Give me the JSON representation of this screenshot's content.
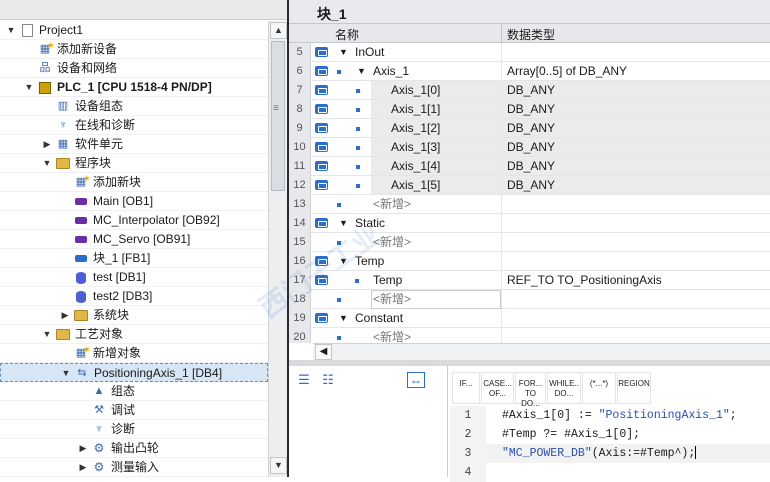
{
  "tree": {
    "items": [
      {
        "label": "Project1",
        "icon": "project-icon",
        "arrow": "▼",
        "indent": 0
      },
      {
        "label": "添加新设备",
        "icon": "add-device-icon",
        "arrow": "",
        "indent": 1
      },
      {
        "label": "设备和网络",
        "icon": "network-icon",
        "arrow": "",
        "indent": 1
      },
      {
        "label": "PLC_1 [CPU 1518-4 PN/DP]",
        "icon": "plc-icon",
        "arrow": "▼",
        "indent": 1,
        "bold": true
      },
      {
        "label": "设备组态",
        "icon": "device-config-icon",
        "arrow": "",
        "indent": 2
      },
      {
        "label": "在线和诊断",
        "icon": "online-diagnostics-icon",
        "arrow": "",
        "indent": 2
      },
      {
        "label": "软件单元",
        "icon": "software-units-icon",
        "arrow": "▶",
        "indent": 2
      },
      {
        "label": "程序块",
        "icon": "folder-icon",
        "arrow": "▼",
        "indent": 2
      },
      {
        "label": "添加新块",
        "icon": "add-block-icon",
        "arrow": "",
        "indent": 3
      },
      {
        "label": "Main [OB1]",
        "icon": "ob-icon",
        "arrow": "",
        "indent": 3
      },
      {
        "label": "MC_Interpolator [OB92]",
        "icon": "ob-icon",
        "arrow": "",
        "indent": 3
      },
      {
        "label": "MC_Servo [OB91]",
        "icon": "ob-icon",
        "arrow": "",
        "indent": 3
      },
      {
        "label": "块_1 [FB1]",
        "icon": "fb-icon",
        "arrow": "",
        "indent": 3
      },
      {
        "label": "test [DB1]",
        "icon": "db-icon",
        "arrow": "",
        "indent": 3
      },
      {
        "label": "test2 [DB3]",
        "icon": "db-icon",
        "arrow": "",
        "indent": 3
      },
      {
        "label": "系统块",
        "icon": "folder-icon",
        "arrow": "▶",
        "indent": 3
      },
      {
        "label": "工艺对象",
        "icon": "folder-icon",
        "arrow": "▼",
        "indent": 2
      },
      {
        "label": "新增对象",
        "icon": "add-object-icon",
        "arrow": "",
        "indent": 3
      },
      {
        "label": "PositioningAxis_1 [DB4]",
        "icon": "axis-icon",
        "arrow": "▼",
        "indent": 3,
        "selected": true
      },
      {
        "label": "组态",
        "icon": "configuration-icon",
        "arrow": "",
        "indent": 4
      },
      {
        "label": "调试",
        "icon": "commissioning-icon",
        "arrow": "",
        "indent": 4
      },
      {
        "label": "诊断",
        "icon": "diagnostics-icon",
        "arrow": "",
        "indent": 4
      },
      {
        "label": "输出凸轮",
        "icon": "gear-folder-icon",
        "arrow": "▶",
        "indent": 4
      },
      {
        "label": "测量输入",
        "icon": "gear-folder-icon",
        "arrow": "▶",
        "indent": 4
      }
    ]
  },
  "block": {
    "title": "块_1",
    "col_name": "名称",
    "col_type": "数据类型",
    "rows": [
      {
        "num": "5",
        "level": 0,
        "arrow": "▼",
        "name": "InOut",
        "type": ""
      },
      {
        "num": "6",
        "level": 1,
        "arrow": "▼",
        "bullet": true,
        "name": "Axis_1",
        "type": "Array[0..5] of DB_ANY"
      },
      {
        "num": "7",
        "level": 2,
        "bullet": true,
        "name": "Axis_1[0]",
        "type": "DB_ANY",
        "shade": true
      },
      {
        "num": "8",
        "level": 2,
        "bullet": true,
        "name": "Axis_1[1]",
        "type": "DB_ANY",
        "shade": true
      },
      {
        "num": "9",
        "level": 2,
        "bullet": true,
        "name": "Axis_1[2]",
        "type": "DB_ANY",
        "shade": true
      },
      {
        "num": "10",
        "level": 2,
        "bullet": true,
        "name": "Axis_1[3]",
        "type": "DB_ANY",
        "shade": true
      },
      {
        "num": "11",
        "level": 2,
        "bullet": true,
        "name": "Axis_1[4]",
        "type": "DB_ANY",
        "shade": true
      },
      {
        "num": "12",
        "level": 2,
        "bullet": true,
        "name": "Axis_1[5]",
        "type": "DB_ANY",
        "shade": true
      },
      {
        "num": "13",
        "level": 1,
        "bullet": true,
        "name": "<新增>",
        "type": "",
        "new": true,
        "noicon": true
      },
      {
        "num": "14",
        "level": 0,
        "arrow": "▼",
        "name": "Static",
        "type": ""
      },
      {
        "num": "15",
        "level": 1,
        "bullet": true,
        "name": "<新增>",
        "type": "",
        "new": true,
        "noicon": true
      },
      {
        "num": "16",
        "level": 0,
        "arrow": "▼",
        "name": "Temp",
        "type": ""
      },
      {
        "num": "17",
        "level": 1,
        "bullet": true,
        "name": "Temp",
        "type": "REF_TO TO_PositioningAxis"
      },
      {
        "num": "18",
        "level": 1,
        "bullet": true,
        "name": "<新增>",
        "type": "",
        "new": true,
        "noicon": true,
        "box": true
      },
      {
        "num": "19",
        "level": 0,
        "arrow": "▼",
        "name": "Constant",
        "type": ""
      },
      {
        "num": "20",
        "level": 1,
        "bullet": true,
        "name": "<新增>",
        "type": "",
        "new": true,
        "noicon": true
      }
    ]
  },
  "editor": {
    "keywords": [
      "IF...",
      "CASE... OF...",
      "FOR... TO DO...",
      "WHILE.. DO...",
      "(*...*)",
      "REGION"
    ],
    "lines": [
      {
        "num": "1",
        "parts": [
          {
            "t": "#Axis_1[0] := ",
            "c": "var"
          },
          {
            "t": "\"PositioningAxis_1\"",
            "c": "str"
          },
          {
            "t": ";",
            "c": "var"
          }
        ]
      },
      {
        "num": "2",
        "parts": [
          {
            "t": "#Temp ?= #Axis_1[0];",
            "c": "var"
          }
        ]
      },
      {
        "num": "3",
        "parts": [
          {
            "t": "\"MC_POWER_DB\"",
            "c": "str"
          },
          {
            "t": "(Axis:=#Temp^);",
            "c": "var"
          }
        ],
        "current": true
      },
      {
        "num": "4",
        "parts": []
      }
    ]
  },
  "colors": {
    "accent": "#2a6fd0",
    "selection": "#d6e6f5"
  }
}
